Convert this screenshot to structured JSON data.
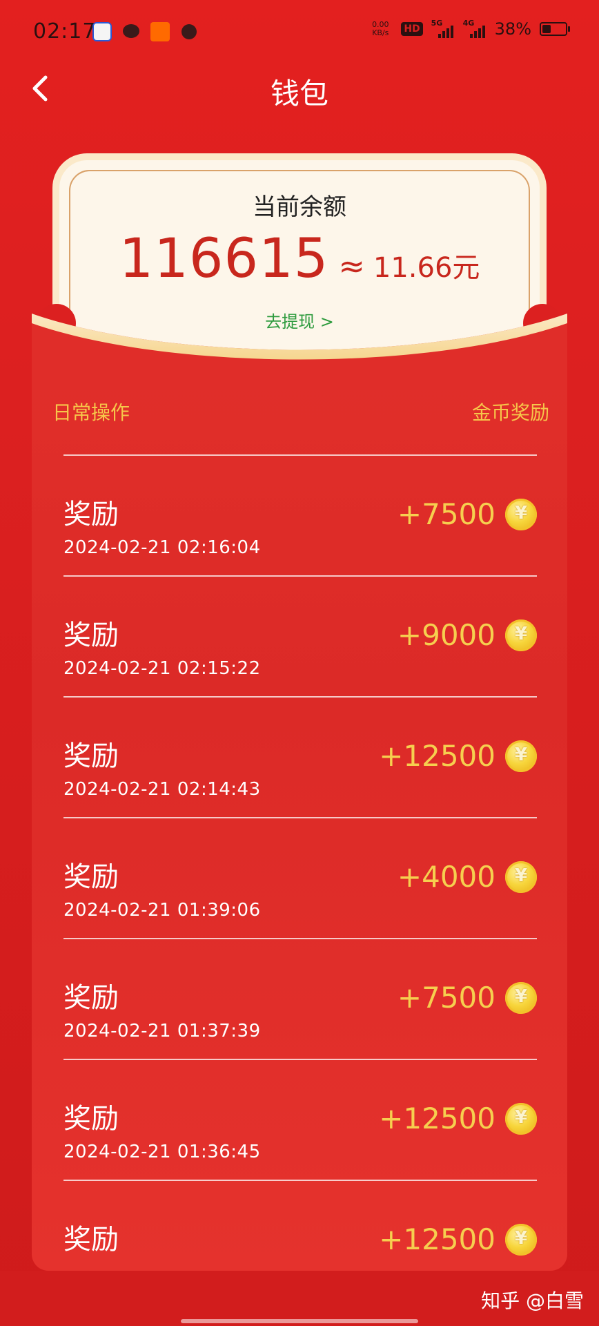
{
  "status_bar": {
    "time": "02:17",
    "net_speed_value": "0.00",
    "net_speed_unit": "KB/s",
    "hd_label": "HD",
    "signal_1": "5G",
    "signal_2": "4G",
    "battery_percent": "38%",
    "battery_level": 0.38,
    "app_icons": [
      "app-icon",
      "chat-icon",
      "taobao-icon",
      "notification-icon"
    ]
  },
  "header": {
    "title": "钱包",
    "back_icon": "chevron-left-icon"
  },
  "balance": {
    "label": "当前余额",
    "coins": "116615",
    "approx": "≈",
    "yuan": "11.66元",
    "withdraw": "去提现 >"
  },
  "list": {
    "header_left": "日常操作",
    "header_right": "金币奖励",
    "items": [
      {
        "title": "奖励",
        "time": "2024-02-21 02:16:04",
        "amount": "+7500"
      },
      {
        "title": "奖励",
        "time": "2024-02-21 02:15:22",
        "amount": "+9000"
      },
      {
        "title": "奖励",
        "time": "2024-02-21 02:14:43",
        "amount": "+12500"
      },
      {
        "title": "奖励",
        "time": "2024-02-21 01:39:06",
        "amount": "+4000"
      },
      {
        "title": "奖励",
        "time": "2024-02-21 01:37:39",
        "amount": "+7500"
      },
      {
        "title": "奖励",
        "time": "2024-02-21 01:36:45",
        "amount": "+12500"
      },
      {
        "title": "奖励",
        "time": "",
        "amount": "+12500"
      }
    ]
  },
  "watermark": "知乎 @白雪",
  "colors": {
    "background": "#dc2020",
    "card": "#fdf6ea",
    "balance_text": "#c8271d",
    "gold": "#f6cf4f",
    "link_green": "#2e9b3e"
  }
}
